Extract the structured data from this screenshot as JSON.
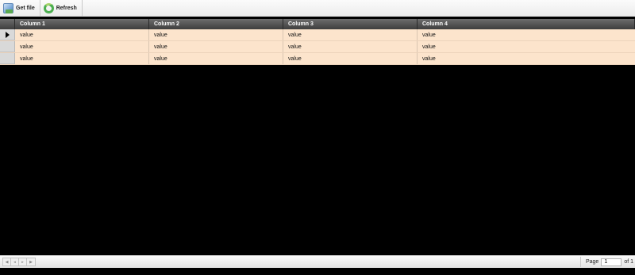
{
  "toolbar": {
    "get_file_label": "Get file",
    "refresh_label": "Refresh"
  },
  "grid": {
    "columns": [
      "Column 1",
      "Column 2",
      "Column 3",
      "Column 4"
    ],
    "rows": [
      [
        "value",
        "value",
        "value",
        "value"
      ],
      [
        "value",
        "value",
        "value",
        "value"
      ],
      [
        "value",
        "value",
        "value",
        "value"
      ]
    ],
    "current_row": 0
  },
  "pager": {
    "page_label": "Page",
    "page_value": "1",
    "of_label": "of 1"
  },
  "colors": {
    "row_bg": "#fce4cc",
    "header_bg": "#4f4f4f",
    "body_bg": "#000000"
  }
}
